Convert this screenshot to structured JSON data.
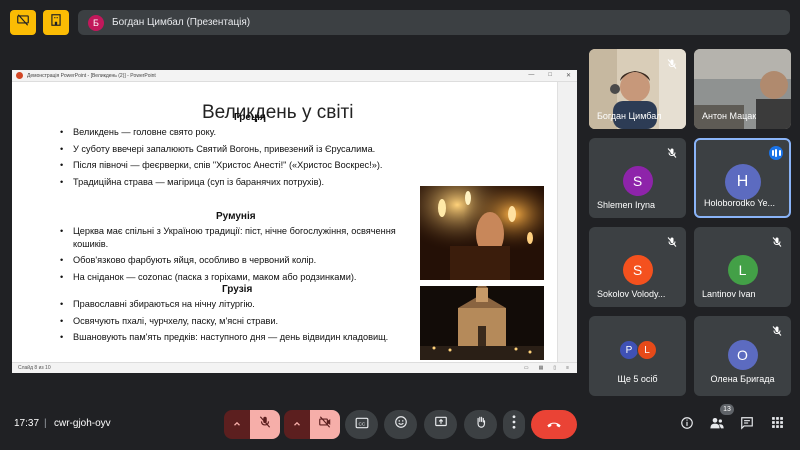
{
  "header": {
    "presenter_initial": "Б",
    "presenter_label": "Богдан Цимбал (Презентація)",
    "colors": {
      "warning_btn": "#fbbc04",
      "avatar": "#c2185b"
    }
  },
  "powerpoint": {
    "window_title": "Демонстрація PowerPoint - [Великдень (2)] - PowerPoint",
    "status_text": "Слайд 8 из 10",
    "slide": {
      "title": "Великдень у світі",
      "sections": [
        {
          "heading": "Греція",
          "bullets": [
            "Великдень — головне свято року.",
            "У суботу ввечері запалюють Святий Вогонь, привезений із Єрусалима.",
            "Після півночі — феєрверки, спів \"Христос Анесті!\" («Христос Воскрес!»).",
            "Традиційна страва — магірица (суп із баранячих потрухів)."
          ]
        },
        {
          "heading": "Румунія",
          "bullets": [
            "Церква має спільні з Україною традиції: піст, нічне богослужіння, освячення кошиків.",
            "Обов'язково фарбують яйця, особливо в червоний колір.",
            "На сніданок — cozonac (паска з горіхами, маком або родзинками)."
          ]
        },
        {
          "heading": "Грузія",
          "bullets": [
            "Православні збираються на нічну літургію.",
            "Освячують пхалі, чурчхелу, паску, м'ясні страви.",
            "Вшановують пам'ять предків: наступного дня — день відвидин кладовищ."
          ]
        }
      ]
    }
  },
  "participants": [
    {
      "name": "Богдан Цимбал",
      "type": "video",
      "muted": true
    },
    {
      "name": "Антон Мацак",
      "type": "video",
      "muted": false
    },
    {
      "name": "Shlemen Iryna",
      "initial": "S",
      "color": "#8e24aa",
      "muted": true
    },
    {
      "name": "Holoborodko Ye...",
      "initial": "H",
      "color": "#5c6bc0",
      "speaking": true
    },
    {
      "name": "Sokolov Volody...",
      "initial": "S",
      "color": "#f4511e",
      "muted": true
    },
    {
      "name": "Lantinov Ivan",
      "initial": "L",
      "color": "#43a047",
      "muted": true
    },
    {
      "name": "Ще 5 осіб",
      "initials": [
        "P",
        "L"
      ],
      "colors": [
        "#3f51b5",
        "#e64a19"
      ]
    },
    {
      "name": "Олена Бригада",
      "initial": "O",
      "color": "#5c6bc0",
      "muted": true
    }
  ],
  "bottom_bar": {
    "time": "17:37",
    "separator": "|",
    "meeting_code": "cwr-gjoh-oyv",
    "participants_count": "13",
    "colors": {
      "end_call": "#ea4335",
      "off_state": "#f6aea9"
    }
  }
}
